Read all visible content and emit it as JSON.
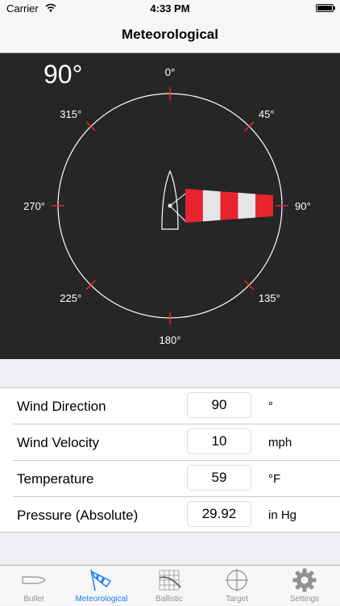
{
  "status_bar": {
    "carrier": "Carrier",
    "time": "4:33 PM",
    "battery_level": 1.0
  },
  "nav": {
    "title": "Meteorological"
  },
  "compass": {
    "heading_readout": "90°",
    "wind_direction_deg": 90,
    "labels": [
      "0°",
      "45°",
      "90°",
      "135°",
      "180°",
      "225°",
      "270°",
      "315°"
    ],
    "colors": {
      "background": "#262628",
      "ring": "#ffffff",
      "tick": "#e8242e",
      "windsock_red": "#e8242e",
      "windsock_white": "#e6e6e6"
    }
  },
  "form": {
    "rows": [
      {
        "label": "Wind Direction",
        "value": "90",
        "unit": "°"
      },
      {
        "label": "Wind Velocity",
        "value": "10",
        "unit": "mph"
      },
      {
        "label": "Temperature",
        "value": "59",
        "unit": "°F"
      },
      {
        "label": "Pressure (Absolute)",
        "value": "29.92",
        "unit": "in Hg"
      }
    ]
  },
  "tabs": [
    {
      "label": "Bullet",
      "icon": "bullet-icon",
      "active": false
    },
    {
      "label": "Meteorological",
      "icon": "windsock-icon",
      "active": true
    },
    {
      "label": "Ballistic",
      "icon": "ballistic-chart-icon",
      "active": false
    },
    {
      "label": "Target",
      "icon": "crosshair-icon",
      "active": false
    },
    {
      "label": "Settings",
      "icon": "gear-icon",
      "active": false
    }
  ],
  "accent_color": "#1a7cf5"
}
